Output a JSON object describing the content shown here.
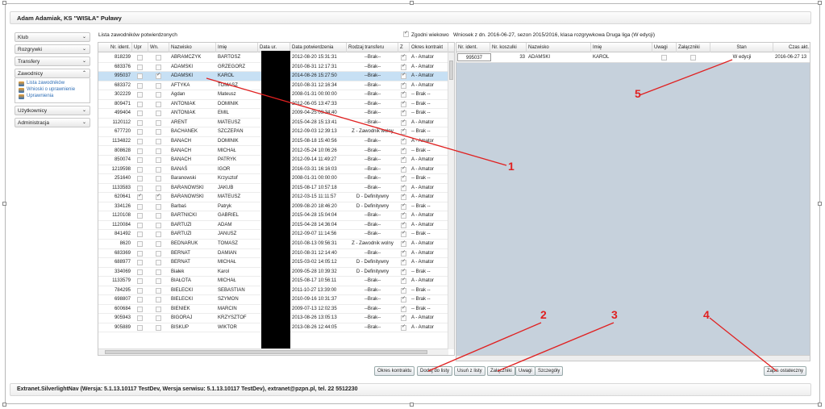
{
  "header": {
    "title": "Adam Adamiak, KS \"WISŁA\" Puławy"
  },
  "sidebar": {
    "sections": [
      {
        "label": "Klub",
        "icon": "chevron-down-icon"
      },
      {
        "label": "Rozgrywki",
        "icon": "chevron-down-icon"
      },
      {
        "label": "Transfery",
        "icon": "chevron-down-icon"
      },
      {
        "label": "Zawodnicy",
        "icon": "chevron-up-icon",
        "items": [
          "Lista zawodników",
          "Wnioski o uprawnienie",
          "Uprawnienia"
        ]
      },
      {
        "label": "Użytkownicy",
        "icon": "chevron-down-icon"
      },
      {
        "label": "Administracja",
        "icon": "chevron-down-icon"
      }
    ]
  },
  "players": {
    "caption": "Lista zawodników potwierdzonych",
    "columns": [
      "Nr. ident.",
      "Upr",
      "Wn.",
      "Nazwisko",
      "Imię",
      "Data ur.",
      "Data potwierdzenia",
      "Rodzaj transferu",
      "Z",
      "Okres kontrakt"
    ],
    "rows": [
      {
        "id": "818239",
        "upr": false,
        "wn": false,
        "last": "ABRAMCZYK",
        "first": "BARTOSZ",
        "date": "2012-08-20 15:31:31",
        "transfer": "--Brak--",
        "z": true,
        "period": "A - Amator"
      },
      {
        "id": "683376",
        "upr": false,
        "wn": false,
        "last": "ADAMSKI",
        "first": "GRZEGORZ",
        "date": "2010-08-31 12:17:31",
        "transfer": "--Brak--",
        "z": true,
        "period": "A - Amator"
      },
      {
        "id": "995037",
        "upr": false,
        "wn": true,
        "last": "ADAMSKI",
        "first": "KAROL",
        "date": "2014-08-26 15:27:50",
        "transfer": "--Brak--",
        "z": true,
        "period": "A - Amator",
        "selected": true
      },
      {
        "id": "683372",
        "upr": false,
        "wn": false,
        "last": "AFTYKA",
        "first": "TOMASZ",
        "date": "2010-08-31 12:16:34",
        "transfer": "--Brak--",
        "z": true,
        "period": "A - Amator"
      },
      {
        "id": "302229",
        "upr": false,
        "wn": false,
        "last": "Agdan",
        "first": "Mateusz",
        "date": "2008-01-31 00:00:00",
        "transfer": "--Brak--",
        "z": true,
        "period": "-- Brak --"
      },
      {
        "id": "809471",
        "upr": false,
        "wn": false,
        "last": "ANTONIAK",
        "first": "DOMINIK",
        "date": "2012-06-05 13:47:33",
        "transfer": "--Brak--",
        "z": true,
        "period": "-- Brak --"
      },
      {
        "id": "499404",
        "upr": false,
        "wn": false,
        "last": "ANTONIAK",
        "first": "EMIL",
        "date": "2009-04-25 09:34:40",
        "transfer": "--Brak--",
        "z": true,
        "period": "-- Brak --"
      },
      {
        "id": "1120112",
        "upr": false,
        "wn": false,
        "last": "ARENT",
        "first": "MATEUSZ",
        "date": "2015-04-28 15:13:41",
        "transfer": "--Brak--",
        "z": true,
        "period": "A - Amator"
      },
      {
        "id": "677720",
        "upr": false,
        "wn": false,
        "last": "BACHANEK",
        "first": "SZCZEPAN",
        "date": "2012-09-03 12:39:13",
        "transfer": "Z - Zawodnik wolny",
        "z": true,
        "period": "-- Brak --"
      },
      {
        "id": "1134822",
        "upr": false,
        "wn": false,
        "last": "BANACH",
        "first": "DOMINIK",
        "date": "2015-08-18 15:40:56",
        "transfer": "--Brak--",
        "z": true,
        "period": "A - Amator"
      },
      {
        "id": "808628",
        "upr": false,
        "wn": false,
        "last": "BANACH",
        "first": "MICHAŁ",
        "date": "2012-05-24 10:06:26",
        "transfer": "--Brak--",
        "z": true,
        "period": "-- Brak --"
      },
      {
        "id": "850074",
        "upr": false,
        "wn": false,
        "last": "BANACH",
        "first": "PATRYK",
        "date": "2012-09-14 11:49:27",
        "transfer": "--Brak--",
        "z": true,
        "period": "A - Amator"
      },
      {
        "id": "1219598",
        "upr": false,
        "wn": false,
        "last": "BANAŚ",
        "first": "IGOR",
        "date": "2016-03-31 16:16:03",
        "transfer": "--Brak--",
        "z": true,
        "period": "A - Amator"
      },
      {
        "id": "251640",
        "upr": false,
        "wn": false,
        "last": "Baranowski",
        "first": "Krzysztof",
        "date": "2008-01-31 00:00:00",
        "transfer": "--Brak--",
        "z": true,
        "period": "-- Brak --"
      },
      {
        "id": "1133583",
        "upr": false,
        "wn": false,
        "last": "BARANOWSKI",
        "first": "JAKUB",
        "date": "2015-08-17 10:57:18",
        "transfer": "--Brak--",
        "z": true,
        "period": "A - Amator"
      },
      {
        "id": "620641",
        "upr": true,
        "wn": true,
        "last": "BARANOWSKI",
        "first": "MATEUSZ",
        "date": "2012-03-15 11:11:57",
        "transfer": "D - Definitywny",
        "z": true,
        "period": "A - Amator"
      },
      {
        "id": "334126",
        "upr": false,
        "wn": false,
        "last": "Barbaś",
        "first": "Patryk",
        "date": "2009-08-20 18:46:20",
        "transfer": "D - Definitywny",
        "z": true,
        "period": "-- Brak --"
      },
      {
        "id": "1120108",
        "upr": false,
        "wn": false,
        "last": "BARTNICKI",
        "first": "GABRIEL",
        "date": "2015-04-28 15:04:04",
        "transfer": "--Brak--",
        "z": true,
        "period": "A - Amator"
      },
      {
        "id": "1120084",
        "upr": false,
        "wn": false,
        "last": "BARTUZI",
        "first": "ADAM",
        "date": "2015-04-28 14:36:04",
        "transfer": "--Brak--",
        "z": true,
        "period": "A - Amator"
      },
      {
        "id": "841492",
        "upr": false,
        "wn": false,
        "last": "BARTUZI",
        "first": "JANUSZ",
        "date": "2012-09-07 11:14:56",
        "transfer": "--Brak--",
        "z": true,
        "period": "-- Brak --"
      },
      {
        "id": "8620",
        "upr": false,
        "wn": false,
        "last": "BEDNARUK",
        "first": "TOMASZ",
        "date": "2010-08-13 09:56:31",
        "transfer": "Z - Zawodnik wolny",
        "z": true,
        "period": "A - Amator"
      },
      {
        "id": "683369",
        "upr": false,
        "wn": false,
        "last": "BERNAT",
        "first": "DAMIAN",
        "date": "2010-08-31 12:14:40",
        "transfer": "--Brak--",
        "z": true,
        "period": "A - Amator"
      },
      {
        "id": "688977",
        "upr": false,
        "wn": false,
        "last": "BERNAT",
        "first": "MICHAŁ",
        "date": "2015-03-02 14:05:12",
        "transfer": "D - Definitywny",
        "z": true,
        "period": "A - Amator"
      },
      {
        "id": "334069",
        "upr": false,
        "wn": false,
        "last": "Białek",
        "first": "Karol",
        "date": "2009-05-28 10:39:32",
        "transfer": "D - Definitywny",
        "z": true,
        "period": "-- Brak --"
      },
      {
        "id": "1133579",
        "upr": false,
        "wn": false,
        "last": "BIAŁOTA",
        "first": "MICHAŁ",
        "date": "2015-08-17 10:56:11",
        "transfer": "--Brak--",
        "z": true,
        "period": "A - Amator"
      },
      {
        "id": "784295",
        "upr": false,
        "wn": false,
        "last": "BIELECKI",
        "first": "SEBASTIAN",
        "date": "2011-10-27 13:39:00",
        "transfer": "--Brak--",
        "z": true,
        "period": "-- Brak --"
      },
      {
        "id": "698807",
        "upr": false,
        "wn": false,
        "last": "BIELECKI",
        "first": "SZYMON",
        "date": "2010-09-16 10:31:37",
        "transfer": "--Brak--",
        "z": true,
        "period": "-- Brak --"
      },
      {
        "id": "600684",
        "upr": false,
        "wn": false,
        "last": "BIENIEK",
        "first": "MARCIN",
        "date": "2009-07-13 12:02:35",
        "transfer": "--Brak--",
        "z": true,
        "period": "-- Brak --"
      },
      {
        "id": "905943",
        "upr": false,
        "wn": false,
        "last": "BIGORAJ",
        "first": "KRZYSZTOF",
        "date": "2013-08-26 13:05:13",
        "transfer": "--Brak--",
        "z": true,
        "period": "A - Amator"
      },
      {
        "id": "905889",
        "upr": false,
        "wn": false,
        "last": "BISKUP",
        "first": "WIKTOR",
        "date": "2013-08-26 12:44:05",
        "transfer": "--Brak--",
        "z": true,
        "period": "A - Amator"
      }
    ]
  },
  "request": {
    "age_check_label": "Zgodni wiekowo",
    "age_check": true,
    "info": "Wniosek z dn. 2016-06-27, sezon 2015/2016, klasa rozgrywkowa Druga liga (W edycji)",
    "columns": [
      "Nr. ident.",
      "Nr. koszulki",
      "Nazwisko",
      "Imię",
      "Uwagi",
      "Załączniki",
      "Stan",
      "Czas akt."
    ],
    "rows": [
      {
        "id": "995037",
        "shirt": "33",
        "last": "ADAMSKI",
        "first": "KAROL",
        "uwagi": false,
        "zal": false,
        "stan": "W edycji",
        "time": "2016-06-27 13"
      }
    ]
  },
  "buttons": {
    "okres": "Okres kontraktu",
    "dodaj": "Dodaj do listy",
    "usun": "Usuń z listy",
    "zalaczniki": "Załączniki",
    "uwagi": "Uwagi",
    "szczegoly": "Szczegóły",
    "zapis": "Zapis ostateczny"
  },
  "annotations": [
    "1",
    "2",
    "3",
    "4",
    "5"
  ],
  "annotation_color": "#e02020",
  "footer": {
    "text": "Extranet.SilverlightNav (Wersja: 5.1.13.10117 TestDev, Wersja serwisu: 5.1.13.10117 TestDev), extranet@pzpn.pl, tel. 22 5512230"
  }
}
